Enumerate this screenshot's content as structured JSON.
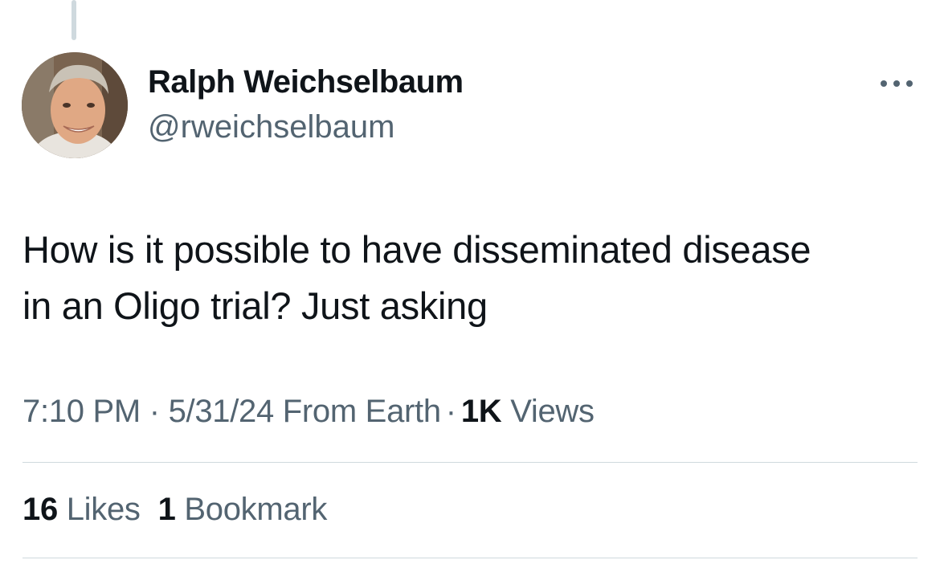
{
  "author": {
    "display_name": "Ralph Weichselbaum",
    "handle": "@rweichselbaum",
    "avatar_icon": "profile-photo"
  },
  "more_icon": "ellipsis-icon",
  "tweet": {
    "text_line1": "How is it possible to have disseminated disease",
    "text_line2": "in an Oligo trial? Just asking"
  },
  "meta": {
    "time": "7:10 PM",
    "separator": "·",
    "date": "5/31/24",
    "source": "From Earth",
    "views_count": "1K",
    "views_label": "Views"
  },
  "stats": {
    "likes_count": "16",
    "likes_label": "Likes",
    "bookmarks_count": "1",
    "bookmarks_label": "Bookmark"
  },
  "colors": {
    "text_primary": "#0f1419",
    "text_secondary": "#536471",
    "divider": "#cfd9de"
  }
}
